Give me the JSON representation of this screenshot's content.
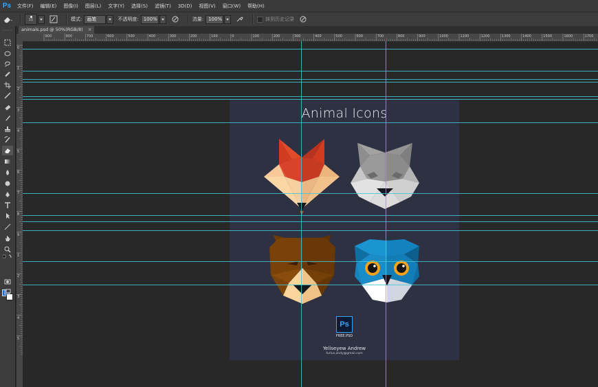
{
  "app": {
    "logo": "Ps"
  },
  "menu": [
    "文件(F)",
    "编辑(E)",
    "图像(I)",
    "图层(L)",
    "文字(Y)",
    "选择(S)",
    "滤镜(T)",
    "3D(D)",
    "视图(V)",
    "窗口(W)",
    "帮助(H)"
  ],
  "options": {
    "brush_size": "11",
    "mode_label": "模式:",
    "mode_value": "画笔",
    "opacity_label": "不透明度:",
    "opacity_value": "100%",
    "flow_label": "流量:",
    "flow_value": "100%",
    "erase_history_label": "抹到历史记录"
  },
  "document": {
    "tab_title": "animals.psd @ 50%(RGB/8)",
    "close_glyph": "×"
  },
  "rulers": {
    "h_labels": [
      "900",
      "800",
      "700",
      "600",
      "500",
      "400",
      "300",
      "200",
      "100",
      "0",
      "100",
      "200",
      "300",
      "400",
      "500",
      "600",
      "700",
      "800",
      "900",
      "1000",
      "1100",
      "1200",
      "1300",
      "1400",
      "1500",
      "1600",
      "1700"
    ],
    "v_labels": [
      "0",
      "1",
      "2",
      "3",
      "4",
      "5",
      "6",
      "7",
      "8",
      "9",
      "1",
      "2",
      "3",
      "4",
      "5"
    ]
  },
  "artboard": {
    "title": "Animal Icons",
    "badge_text": "Ps",
    "badge_caption": "FREE.PSD",
    "author": "Yeliseyew Andrew",
    "email": "furlus.andy@gmail.com"
  },
  "colors": {
    "foreground": "#1e6fe0",
    "background": "#ffffff",
    "guide": "#3fc7d8",
    "artboard": "#2e3142"
  },
  "animals": [
    "fox",
    "wolf",
    "bear",
    "owl"
  ],
  "tools": [
    "marquee-icon",
    "lasso-icon",
    "quick-select-icon",
    "crop-icon",
    "eyedropper-icon",
    "healing-brush-icon",
    "brush-icon",
    "clone-stamp-icon",
    "history-brush-icon",
    "eraser-icon",
    "gradient-icon",
    "blur-icon",
    "dodge-icon",
    "pen-icon",
    "type-icon",
    "path-select-icon",
    "line-icon",
    "hand-icon",
    "zoom-icon"
  ]
}
